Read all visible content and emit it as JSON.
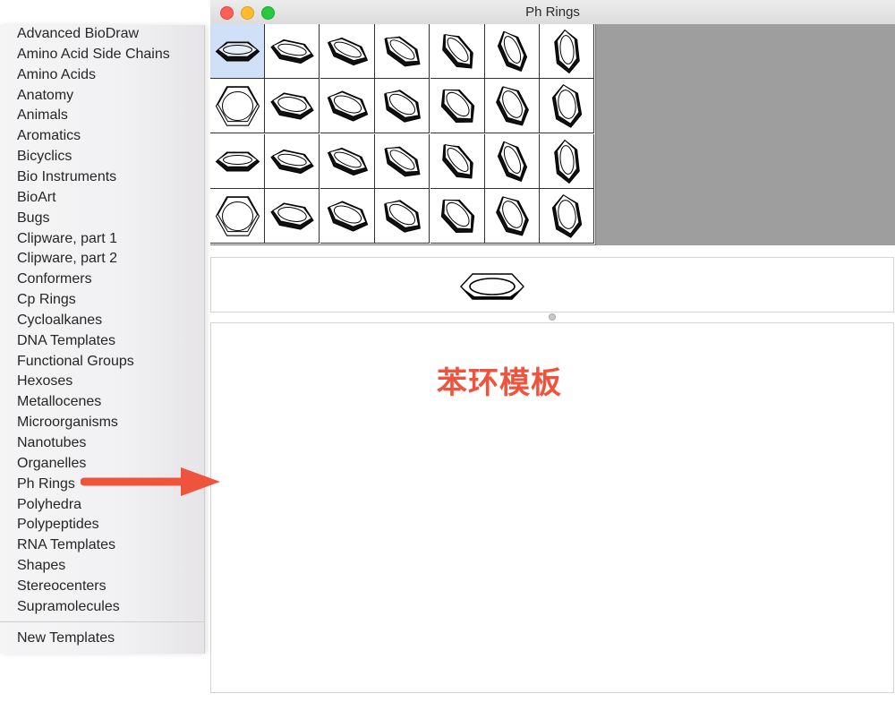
{
  "window": {
    "title": "Ph Rings"
  },
  "menu": {
    "items": [
      "Advanced BioDraw",
      "Amino Acid Side Chains",
      "Amino Acids",
      "Anatomy",
      "Animals",
      "Aromatics",
      "Bicyclics",
      "Bio Instruments",
      "BioArt",
      "Bugs",
      "Clipware, part 1",
      "Clipware, part 2",
      "Conformers",
      "Cp Rings",
      "Cycloalkanes",
      "DNA Templates",
      "Functional Groups",
      "Hexoses",
      "Metallocenes",
      "Microorganisms",
      "Nanotubes",
      "Organelles",
      "Ph Rings",
      "Polyhedra",
      "Polypeptides",
      "RNA Templates",
      "Shapes",
      "Stereocenters",
      "Supramolecules"
    ],
    "footer_item": "New Templates",
    "highlighted_item": "Ph Rings"
  },
  "template_grid": {
    "rows": 4,
    "columns": 7,
    "selected_index": 0,
    "icon": "benzene-ring-icon"
  },
  "annotation": {
    "text": "苯环模板",
    "color": "#f0533c"
  },
  "colors": {
    "accent": "#f0533c",
    "selection": "#cfe0f7",
    "gray_area": "#9e9e9e"
  }
}
